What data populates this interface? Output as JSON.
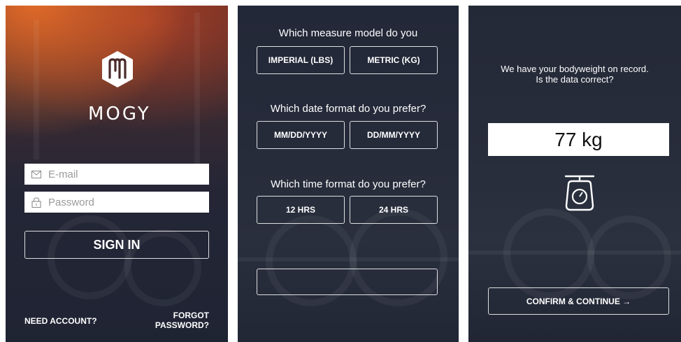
{
  "login": {
    "brand": "MOGY",
    "email_placeholder": "E-mail",
    "password_placeholder": "Password",
    "sign_in_label": "SIGN IN",
    "need_account_label": "NEED ACCOUNT?",
    "forgot_line1": "FORGOT",
    "forgot_line2": "PASSWORD?"
  },
  "prefs": {
    "measure_question": "Which measure model do you",
    "measure_options": [
      "IMPERIAL (LBS)",
      "METRIC (KG)"
    ],
    "date_question": "Which date format do you prefer?",
    "date_options": [
      "MM/DD/YYYY",
      "DD/MM/YYYY"
    ],
    "time_question": "Which time format do you prefer?",
    "time_options": [
      "12 HRS",
      "24 HRS"
    ]
  },
  "weight": {
    "message_line1": "We have your bodyweight on record.",
    "message_line2": "Is the data correct?",
    "weight_value": "77 kg",
    "confirm_label": "CONFIRM & CONTINUE →"
  },
  "colors": {
    "accent_orange": "#e86e28",
    "text_white": "#ffffff"
  },
  "icons": [
    "email-icon",
    "lock-icon",
    "scale-icon",
    "mogy-logo-icon"
  ]
}
